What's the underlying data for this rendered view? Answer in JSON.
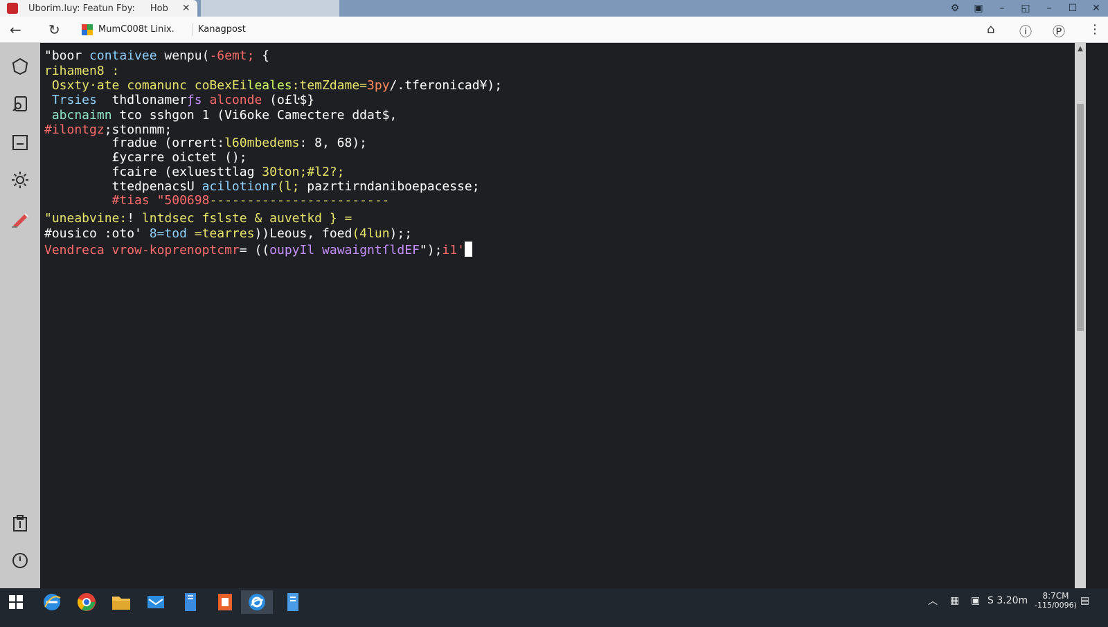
{
  "browser": {
    "tab_title": "Uborim.luy: Featun Fby:",
    "tab_title_2": "Hob",
    "close_glyph": "✕",
    "bookmark_1": "MumC008t Linix.",
    "bookmark_2": "Kanagpost",
    "back_glyph": "←",
    "reload_glyph": "↻"
  },
  "terminal": {
    "lines": [
      {
        "segments": [
          {
            "t": "\"boor ",
            "c": "#ffffff"
          },
          {
            "t": "contaivee ",
            "c": "#8fd1ff"
          },
          {
            "t": "wenpu(",
            "c": "#f5f5f5"
          },
          {
            "t": "-6emt;",
            "c": "#ff6b6b"
          },
          {
            "t": " {",
            "c": "#f5f5f5"
          }
        ]
      },
      {
        "segments": [
          {
            "t": "rihamen8 :",
            "c": "#e8e46a"
          }
        ]
      },
      {
        "segments": [
          {
            "t": " Osxty·ate comanunc coBexEi",
            "c": "#e8e46a"
          },
          {
            "t": "leales",
            "c": "#d0ff66"
          },
          {
            "t": ":tem",
            "c": "#e8e46a"
          },
          {
            "t": "Zdame=",
            "c": "#e8e46a"
          },
          {
            "t": "3py",
            "c": "#ff8a5c"
          },
          {
            "t": "/",
            "c": "#ffffff"
          },
          {
            "t": ".tferonicad¥);",
            "c": "#ffffff"
          }
        ]
      },
      {
        "segments": [
          {
            "t": " Trsies ",
            "c": "#8fd1ff"
          },
          {
            "t": " thdlonamer",
            "c": "#ffffff"
          },
          {
            "t": "ƒs ",
            "c": "#c58fff"
          },
          {
            "t": "alconde ",
            "c": "#ff6b6b"
          },
          {
            "t": "(o£ŀ$}",
            "c": "#ffffff"
          }
        ]
      },
      {
        "segments": [
          {
            "t": " abcnaimn ",
            "c": "#8ee6c4"
          },
          {
            "t": "tco sshgon 1 (Vi6oke Camectere ddat$,",
            "c": "#ffffff"
          }
        ]
      },
      {
        "segments": [
          {
            "t": "#ilontgz",
            "c": "#ff6b6b"
          },
          {
            "t": ";stonnmm;",
            "c": "#ffffff"
          }
        ]
      },
      {
        "segments": [
          {
            "t": "         fradue (orrert:",
            "c": "#ffffff"
          },
          {
            "t": "l60mbedems",
            "c": "#e8e46a"
          },
          {
            "t": ": 8, 68);",
            "c": "#ffffff"
          }
        ]
      },
      {
        "segments": [
          {
            "t": "         £ycarre oictet ();",
            "c": "#ffffff"
          }
        ]
      },
      {
        "segments": [
          {
            "t": "         fcaire (exluestt",
            "c": "#ffffff"
          },
          {
            "t": "lag ",
            "c": "#ffffff"
          },
          {
            "t": "30ton;#l2?;",
            "c": "#e8e46a"
          }
        ]
      },
      {
        "segments": [
          {
            "t": "         ttedpenacsU ",
            "c": "#ffffff"
          },
          {
            "t": "acilotionr",
            "c": "#8fd1ff"
          },
          {
            "t": "(l;",
            "c": "#e8e46a"
          },
          {
            "t": " pazrtirndanibo",
            "c": "#ffffff"
          },
          {
            "t": "epacesse;",
            "c": "#ffffff"
          }
        ]
      },
      {
        "segments": [
          {
            "t": "         ",
            "c": "#ffffff"
          },
          {
            "t": "#tias \"500698",
            "c": "#ff6b6b"
          },
          {
            "t": "------------------------",
            "c": "#e8e46a"
          }
        ]
      },
      {
        "segments": [
          {
            "t": "\"uneabvine:",
            "c": "#e8e46a"
          },
          {
            "t": "! ",
            "c": "#ffffff"
          },
          {
            "t": "lntdsec ",
            "c": "#e8e46a"
          },
          {
            "t": "fslste & auvetkd } =",
            "c": "#e8e46a"
          }
        ]
      },
      {
        "segments": [
          {
            "t": "#ousico :oto' ",
            "c": "#ffffff"
          },
          {
            "t": "8=tod ",
            "c": "#8fd1ff"
          },
          {
            "t": "=tearres",
            "c": "#e8e46a"
          },
          {
            "t": "))Leous, foed",
            "c": "#ffffff"
          },
          {
            "t": "(4lun",
            "c": "#e8e46a"
          },
          {
            "t": ");;",
            "c": "#ffffff"
          }
        ]
      },
      {
        "segments": [
          {
            "t": "Vendreca ",
            "c": "#ff6b6b"
          },
          {
            "t": "vrow-koprenoptcmr",
            "c": "#ff6b6b"
          },
          {
            "t": "= ",
            "c": "#ffffff"
          },
          {
            "t": "((",
            "c": "#ffffff"
          },
          {
            "t": "oupyIl ",
            "c": "#c58fff"
          },
          {
            "t": "wawaignt",
            "c": "#c58fff"
          },
          {
            "t": "ſldEF",
            "c": "#c58fff"
          },
          {
            "t": "\");",
            "c": "#ffffff"
          },
          {
            "t": "i1'",
            "c": "#ff6b6b"
          }
        ]
      }
    ]
  },
  "tray": {
    "lang": "S 3.20m",
    "time": "8:7CM",
    "date": "-115/0096)"
  },
  "colors": {
    "terminal_bg": "#1e1f22",
    "sidebar_bg": "#c8c8c8",
    "taskbar_bg": "#21272e",
    "titlebar_bg": "#7d98b8"
  }
}
